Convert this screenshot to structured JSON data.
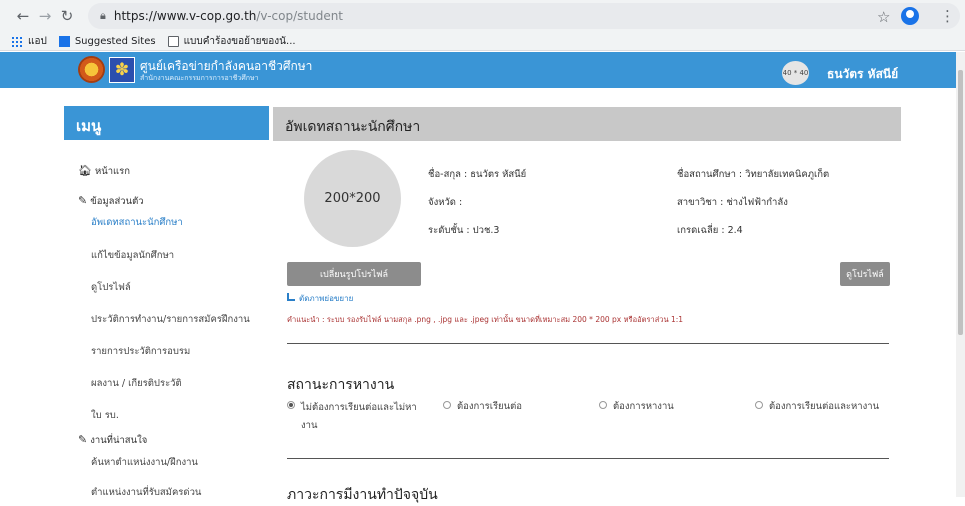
{
  "browser": {
    "url_host": "https://www.v-cop.go.th",
    "url_path": "/v-cop/student",
    "bookmarks": [
      {
        "label": "แอป"
      },
      {
        "label": "Suggested Sites"
      },
      {
        "label": "แบบคำร้องขอย้ายของนั..."
      }
    ]
  },
  "header": {
    "title": "ศูนย์เครือข่ายกำลังคนอาชีวศึกษา",
    "subtitle": "สำนักงานคณะกรรมการการอาชีวศึกษา",
    "avatar_text": "40 * 40",
    "username": "ธนวัตร หัสนีย์",
    "brand_color": "#3a95d6"
  },
  "sidebar": {
    "menu_title": "เมนู",
    "home": "หน้าแรก",
    "personal_section": "ข้อมูลส่วนตัว",
    "personal_items": [
      "อัพเดทสถานะนักศึกษา",
      "แก้ไขข้อมูลนักศึกษา",
      "ดูโปรไฟล์",
      "ประวัติการทำงาน/รายการสมัครฝึกงาน",
      "รายการประวัติการอบรม",
      "ผลงาน / เกียรติประวัติ",
      "ใบ รบ."
    ],
    "jobs_section": "งานที่น่าสนใจ",
    "jobs_items": [
      "ค้นหาตำแหน่งงาน/ฝึกงาน",
      "ตำแหน่งงานที่รับสมัครด่วน"
    ]
  },
  "content": {
    "title": "อัพเดทสถานะนักศึกษา",
    "photo_placeholder": "200*200",
    "name": "ชื่อ-สกุล : ธนวัตร หัสนีย์",
    "province": "จังหวัด :",
    "level": "ระดับชั้น : ปวช.3",
    "school": "ชื่อสถานศึกษา : วิทยาลัยเทคนิคภูเก็ต",
    "major": "สาขาวิชา : ช่างไฟฟ้ากำลัง",
    "gpa": "เกรดเฉลี่ย : 2.4",
    "change_photo_label": "เปลี่ยนรูปโปรไฟล์",
    "view_profile_label": "ดูโปรไฟล์",
    "enlarge_label": "ตัดภาพย่อขยาย",
    "note": "คำแนะนำ : ระบบ รองรับไฟล์ นามสกุล .png , .jpg และ .jpeg เท่านั้น ขนาดที่เหมาะสม 200 * 200 px หรืออัตราส่วน 1:1",
    "status_title": "สถานะการหางาน",
    "status_options": [
      {
        "label": "ไม่ต้องการเรียนต่อและไม่หางาน",
        "selected": true
      },
      {
        "label": "ต้องการเรียนต่อ",
        "selected": false
      },
      {
        "label": "ต้องการหางาน",
        "selected": false
      },
      {
        "label": "ต้องการเรียนต่อและหางาน",
        "selected": false
      }
    ],
    "employment_title": "ภาวะการมีงานทำปัจจุบัน"
  }
}
